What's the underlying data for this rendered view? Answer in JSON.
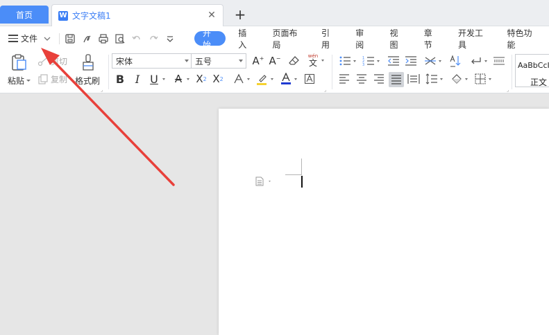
{
  "tabs": {
    "home_label": "首页",
    "doc_label": "文字文稿1",
    "doc_icon_letter": "W"
  },
  "menu": {
    "file_label": "文件",
    "tabs": [
      "开始",
      "插入",
      "页面布局",
      "引用",
      "审阅",
      "视图",
      "章节",
      "开发工具",
      "特色功能"
    ],
    "active_tab": "开始"
  },
  "ribbon": {
    "paste_label": "粘贴",
    "cut_label": "剪切",
    "copy_label": "复制",
    "format_painter_label": "格式刷",
    "font_name": "宋体",
    "font_size": "五号",
    "pinyin_label": "wén",
    "pinyin_char": "文",
    "style_sample": "AaBbCcI",
    "style_name": "正文"
  },
  "colors": {
    "accent": "#4b8df8",
    "annotation_arrow": "#e8403a",
    "font_color_bar": "#1f3bd1",
    "highlight_bar": "#f5d130"
  }
}
